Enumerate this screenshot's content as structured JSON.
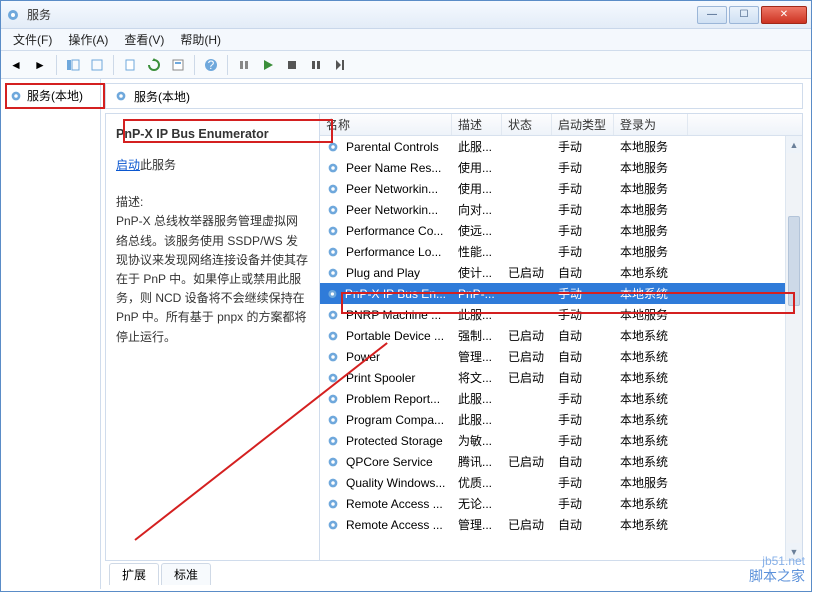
{
  "window": {
    "title": "服务"
  },
  "menu": {
    "file": "文件(F)",
    "action": "操作(A)",
    "view": "查看(V)",
    "help": "帮助(H)"
  },
  "tree": {
    "root": "服务(本地)"
  },
  "panel": {
    "header": "服务(本地)"
  },
  "detail": {
    "name": "PnP-X IP Bus Enumerator",
    "start_link": "启动",
    "start_suffix": "此服务",
    "desc_label": "描述:",
    "desc": "PnP-X 总线枚举器服务管理虚拟网络总线。该服务使用 SSDP/WS 发现协议来发现网络连接设备并使其存在于 PnP 中。如果停止或禁用此服务，则 NCD 设备将不会继续保持在 PnP 中。所有基于 pnpx 的方案都将停止运行。"
  },
  "columns": {
    "name": "名称",
    "desc": "描述",
    "status": "状态",
    "startup": "启动类型",
    "logon": "登录为"
  },
  "services": [
    {
      "name": "Parental Controls",
      "desc": "此服...",
      "status": "",
      "startup": "手动",
      "logon": "本地服务"
    },
    {
      "name": "Peer Name Res...",
      "desc": "使用...",
      "status": "",
      "startup": "手动",
      "logon": "本地服务"
    },
    {
      "name": "Peer Networkin...",
      "desc": "使用...",
      "status": "",
      "startup": "手动",
      "logon": "本地服务"
    },
    {
      "name": "Peer Networkin...",
      "desc": "向对...",
      "status": "",
      "startup": "手动",
      "logon": "本地服务"
    },
    {
      "name": "Performance Co...",
      "desc": "使远...",
      "status": "",
      "startup": "手动",
      "logon": "本地服务"
    },
    {
      "name": "Performance Lo...",
      "desc": "性能...",
      "status": "",
      "startup": "手动",
      "logon": "本地服务"
    },
    {
      "name": "Plug and Play",
      "desc": "使计...",
      "status": "已启动",
      "startup": "自动",
      "logon": "本地系统"
    },
    {
      "name": "PnP-X IP Bus En...",
      "desc": "PnP-...",
      "status": "",
      "startup": "手动",
      "logon": "本地系统",
      "selected": true
    },
    {
      "name": "PNRP Machine ...",
      "desc": "此服...",
      "status": "",
      "startup": "手动",
      "logon": "本地服务"
    },
    {
      "name": "Portable Device ...",
      "desc": "强制...",
      "status": "已启动",
      "startup": "自动",
      "logon": "本地系统"
    },
    {
      "name": "Power",
      "desc": "管理...",
      "status": "已启动",
      "startup": "自动",
      "logon": "本地系统"
    },
    {
      "name": "Print Spooler",
      "desc": "将文...",
      "status": "已启动",
      "startup": "自动",
      "logon": "本地系统"
    },
    {
      "name": "Problem Report...",
      "desc": "此服...",
      "status": "",
      "startup": "手动",
      "logon": "本地系统"
    },
    {
      "name": "Program Compa...",
      "desc": "此服...",
      "status": "",
      "startup": "手动",
      "logon": "本地系统"
    },
    {
      "name": "Protected Storage",
      "desc": "为敏...",
      "status": "",
      "startup": "手动",
      "logon": "本地系统"
    },
    {
      "name": "QPCore Service",
      "desc": "腾讯...",
      "status": "已启动",
      "startup": "自动",
      "logon": "本地系统"
    },
    {
      "name": "Quality Windows...",
      "desc": "优质...",
      "status": "",
      "startup": "手动",
      "logon": "本地服务"
    },
    {
      "name": "Remote Access ...",
      "desc": "无论...",
      "status": "",
      "startup": "手动",
      "logon": "本地系统"
    },
    {
      "name": "Remote Access ...",
      "desc": "管理...",
      "status": "已启动",
      "startup": "自动",
      "logon": "本地系统"
    }
  ],
  "tabs": {
    "ext": "扩展",
    "std": "标准"
  },
  "watermark": {
    "url": "jb51.net",
    "name": "脚本之家"
  }
}
